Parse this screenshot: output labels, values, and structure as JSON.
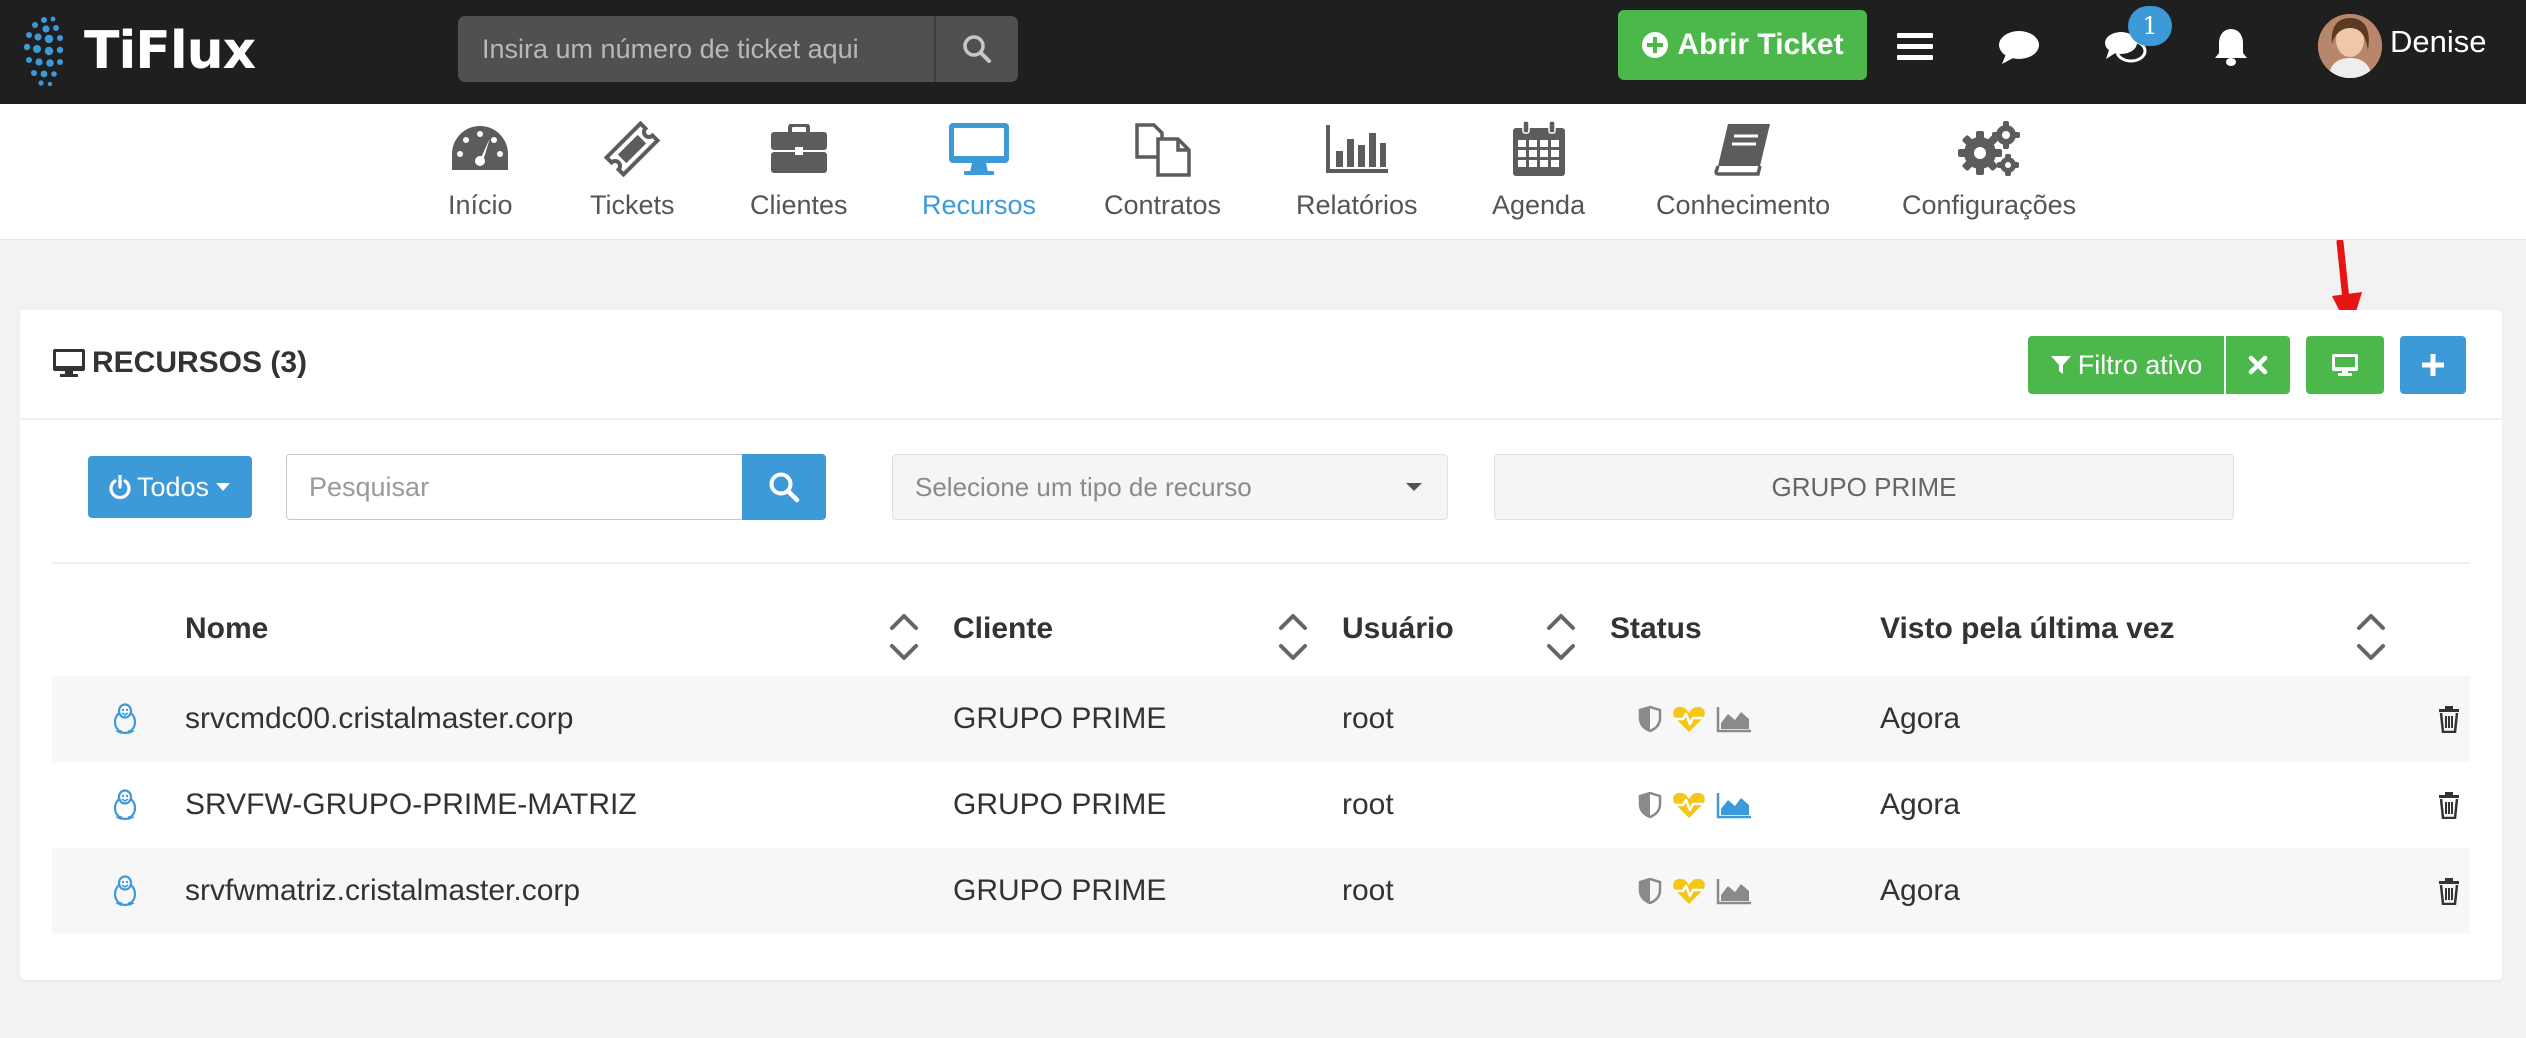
{
  "app": {
    "name": "TiFlux"
  },
  "header": {
    "search_placeholder": "Insira um número de ticket aqui",
    "open_ticket_label": "Abrir Ticket",
    "chat_badge": "1",
    "user_name": "Denise"
  },
  "nav": {
    "items": [
      {
        "label": "Início"
      },
      {
        "label": "Tickets"
      },
      {
        "label": "Clientes"
      },
      {
        "label": "Recursos"
      },
      {
        "label": "Contratos"
      },
      {
        "label": "Relatórios"
      },
      {
        "label": "Agenda"
      },
      {
        "label": "Conhecimento"
      },
      {
        "label": "Configurações"
      }
    ],
    "active": "Recursos"
  },
  "panel": {
    "title": "RECURSOS (3)",
    "filter_active_label": "Filtro ativo"
  },
  "filters": {
    "todos_label": "Todos",
    "search_placeholder": "Pesquisar",
    "resource_type_placeholder": "Selecione um tipo de recurso",
    "client_value": "GRUPO PRIME"
  },
  "table": {
    "columns": [
      "Nome",
      "Cliente",
      "Usuário",
      "Status",
      "Visto pela última vez"
    ],
    "rows": [
      {
        "name": "srvcmdc00.cristalmaster.corp",
        "client": "GRUPO PRIME",
        "user": "root",
        "last_seen": "Agora",
        "monitor_active": false
      },
      {
        "name": "SRVFW-GRUPO-PRIME-MATRIZ",
        "client": "GRUPO PRIME",
        "user": "root",
        "last_seen": "Agora",
        "monitor_active": true
      },
      {
        "name": "srvfwmatriz.cristalmaster.corp",
        "client": "GRUPO PRIME",
        "user": "root",
        "last_seen": "Agora",
        "monitor_active": false
      }
    ]
  },
  "colors": {
    "accent_blue": "#3d9ad9",
    "accent_green": "#4cb84c",
    "topbar": "#1f1f1f",
    "heart_yellow": "#f5c518",
    "arrow_red": "#e81414"
  }
}
